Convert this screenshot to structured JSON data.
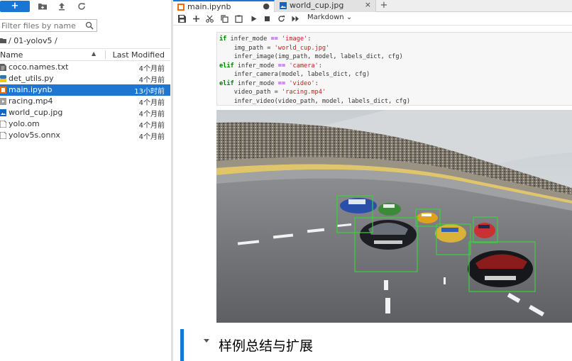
{
  "colors": {
    "accent": "#1976d2",
    "selected_row": "#1e76d3",
    "detection_box": "#39d339"
  },
  "file_browser": {
    "new_button": "+",
    "search_placeholder": "Filter files by name",
    "breadcrumb": "/ 01-yolov5 /",
    "header": {
      "name": "Name",
      "modified": "Last Modified"
    },
    "files": [
      {
        "name": "coco.names.txt",
        "modified": "4个月前",
        "icon": "text-file-icon"
      },
      {
        "name": "det_utils.py",
        "modified": "4个月前",
        "icon": "python-file-icon"
      },
      {
        "name": "main.ipynb",
        "modified": "13小时前",
        "icon": "notebook-file-icon",
        "selected": true
      },
      {
        "name": "racing.mp4",
        "modified": "4个月前",
        "icon": "video-file-icon"
      },
      {
        "name": "world_cup.jpg",
        "modified": "4个月前",
        "icon": "image-file-icon"
      },
      {
        "name": "yolo.om",
        "modified": "4个月前",
        "icon": "file-icon"
      },
      {
        "name": "yolov5s.onnx",
        "modified": "4个月前",
        "icon": "file-icon"
      }
    ]
  },
  "tabs": [
    {
      "label": "main.ipynb",
      "active": true,
      "close": "●"
    },
    {
      "label": "world_cup.jpg",
      "active": false,
      "close": "×"
    }
  ],
  "tab_add": "+",
  "notebook_toolbar": {
    "cell_type": "Markdown"
  },
  "code_lines": [
    "if infer_mode == 'image':",
    "    img_path = 'world_cup.jpg'",
    "    infer_image(img_path, model, labels_dict, cfg)",
    "elif infer_mode == 'camera':",
    "    infer_camera(model, labels_dict, cfg)",
    "elif infer_mode == 'video':",
    "    video_path = 'racing.mp4'",
    "    infer_video(video_path, model, labels_dict, cfg)"
  ],
  "markdown_heading": "样例总结与扩展"
}
